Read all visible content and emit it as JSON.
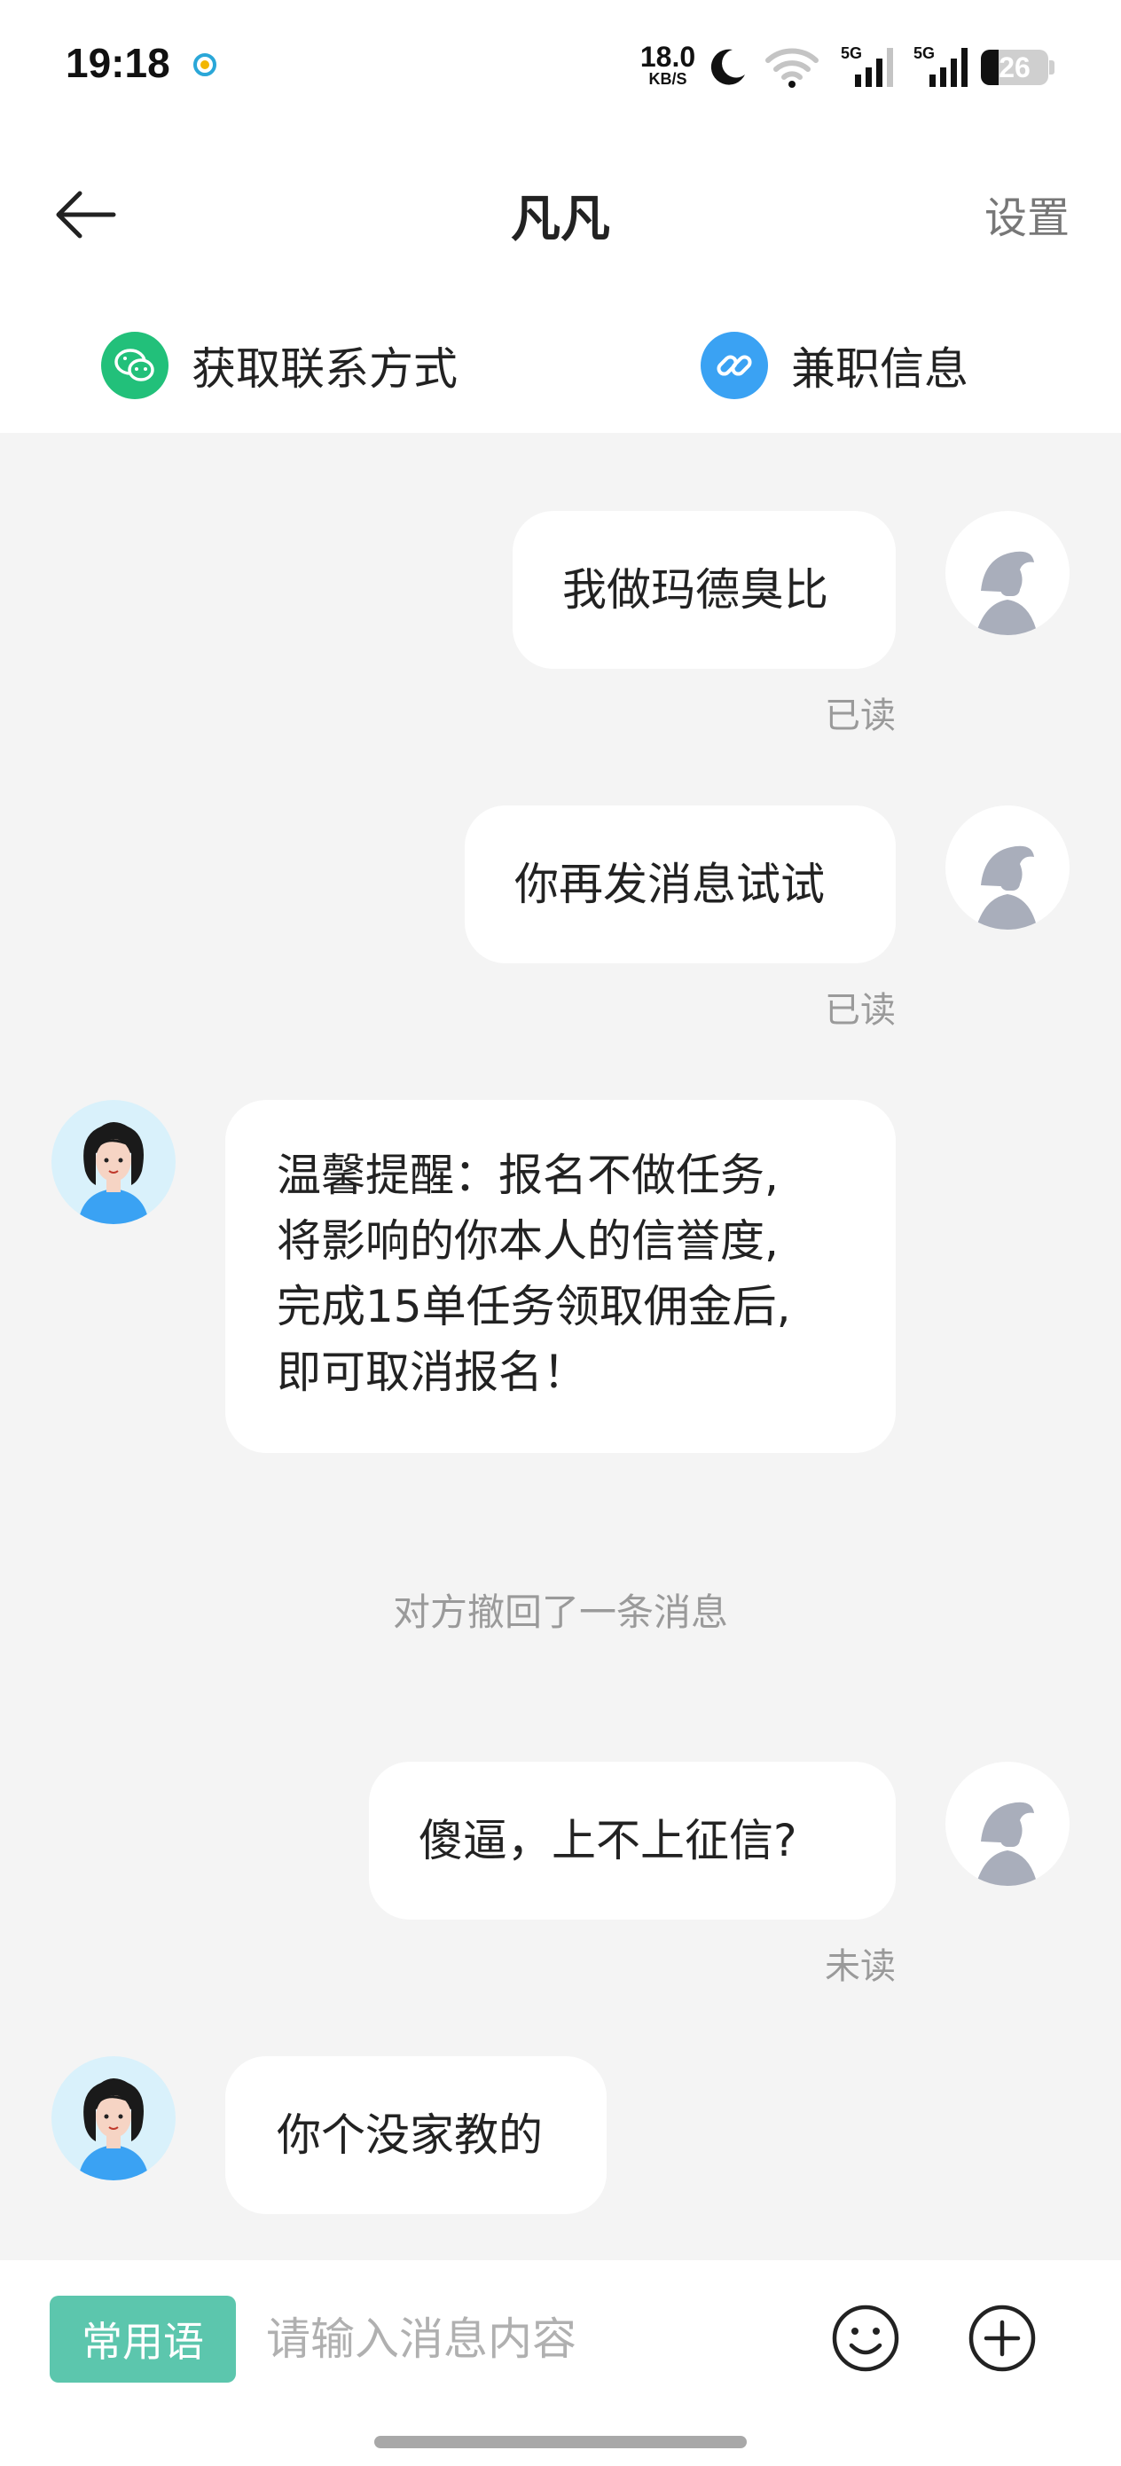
{
  "status_bar": {
    "time": "19:18",
    "net_speed_value": "18.0",
    "net_speed_unit": "KB/S",
    "signal1_label": "5G",
    "signal2_label": "5G",
    "battery_level": "26",
    "icons": [
      "carrier-logo-icon",
      "moon-icon",
      "wifi-icon",
      "signal-icon",
      "battery-icon"
    ]
  },
  "nav": {
    "title": "凡凡",
    "settings_label": "设置"
  },
  "quick_actions": {
    "contact_label": "获取联系方式",
    "job_label": "兼职信息"
  },
  "messages": [
    {
      "side": "right",
      "text": "我做玛德臭比",
      "status": "已读"
    },
    {
      "side": "right",
      "text": "你再发消息试试",
      "status": "已读"
    },
    {
      "side": "left",
      "lines": [
        "温馨提醒：报名不做任务,",
        "将影响的你本人的信誉度,",
        "完成15单任务领取佣金后,",
        "即可取消报名！"
      ]
    },
    {
      "side": "system",
      "text": "对方撤回了一条消息"
    },
    {
      "side": "right",
      "text": "傻逼，上不上征信?",
      "status": "未读"
    },
    {
      "side": "left",
      "text": "你个没家教的"
    }
  ],
  "input_bar": {
    "phrases_label": "常用语",
    "placeholder": "请输入消息内容"
  },
  "colors": {
    "accent_green": "#5cc6ad",
    "wechat_green": "#22c07a",
    "link_blue": "#3aa2f3",
    "chat_background": "#f4f4f4"
  }
}
